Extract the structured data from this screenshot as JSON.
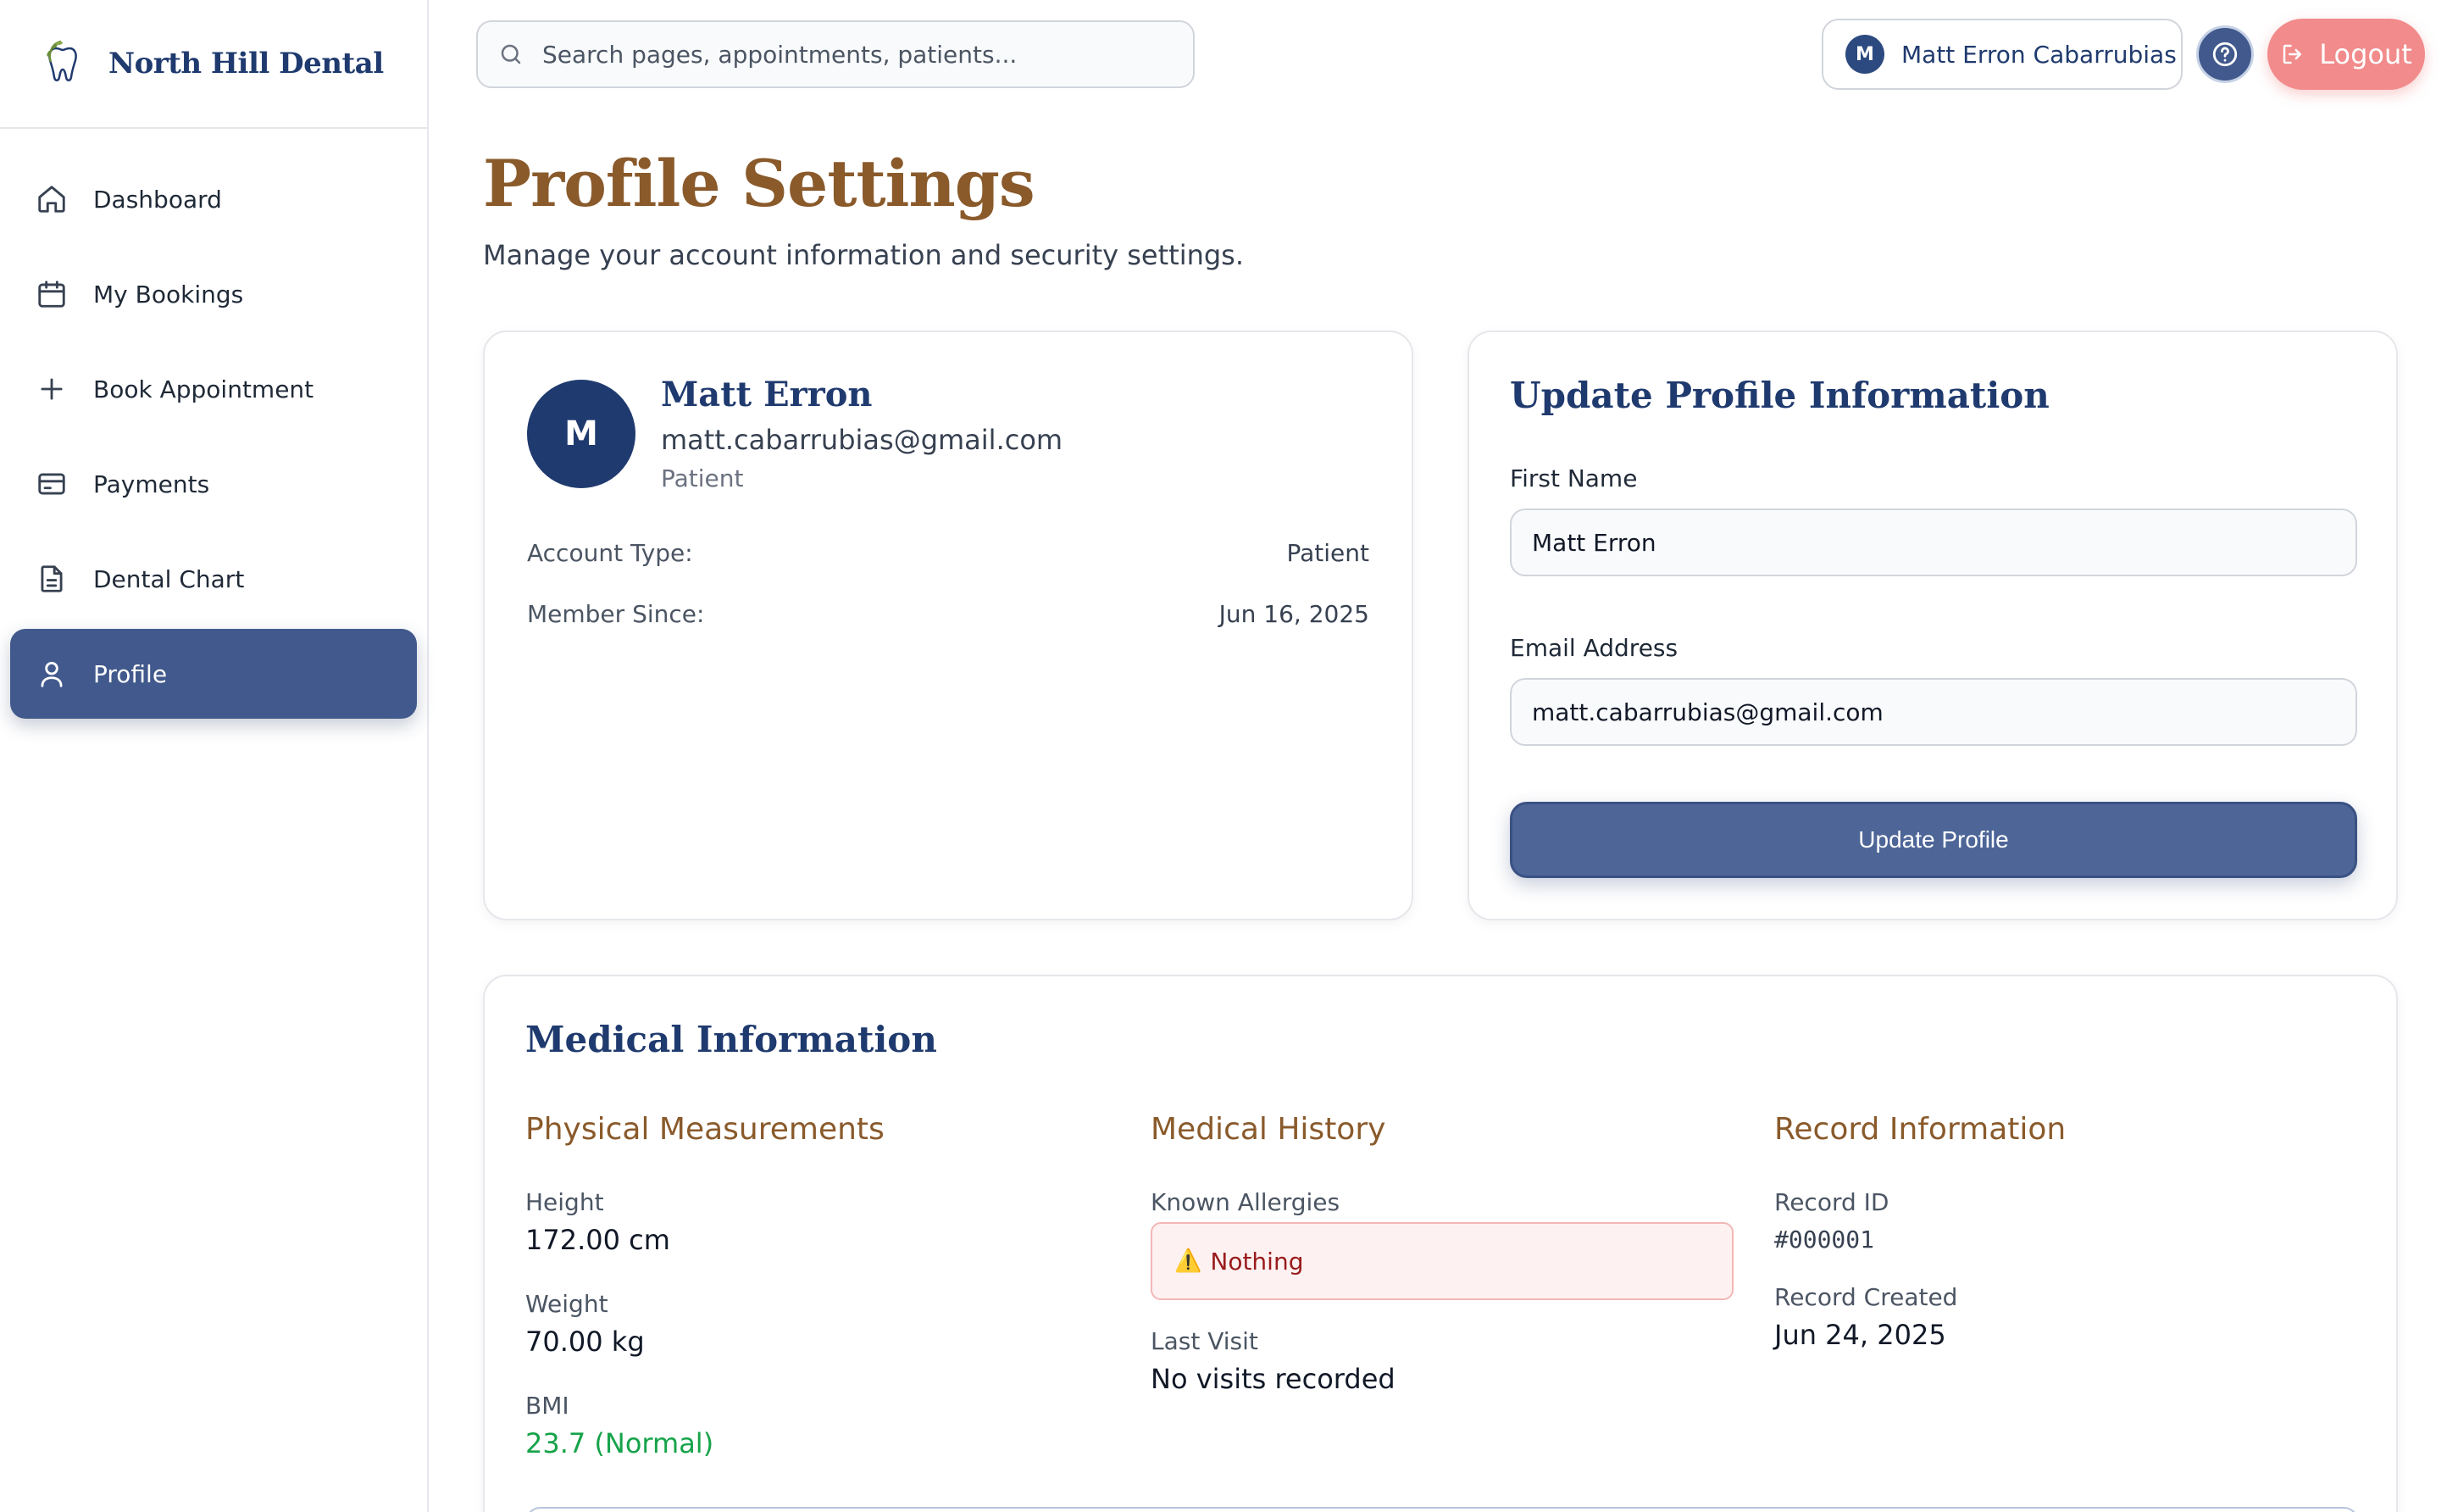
{
  "brand": {
    "name": "North Hill Dental"
  },
  "sidebar": {
    "items": [
      {
        "label": "Dashboard",
        "icon": "home-icon"
      },
      {
        "label": "My Bookings",
        "icon": "calendar-icon"
      },
      {
        "label": "Book Appointment",
        "icon": "plus-icon"
      },
      {
        "label": "Payments",
        "icon": "credit-card-icon"
      },
      {
        "label": "Dental Chart",
        "icon": "document-icon"
      },
      {
        "label": "Profile",
        "icon": "user-icon",
        "active": true
      }
    ]
  },
  "topbar": {
    "search_placeholder": "Search pages, appointments, patients...",
    "user_initial": "M",
    "user_name": "Matt Erron Cabarrubias",
    "logout_label": "Logout"
  },
  "header": {
    "title": "Profile Settings",
    "subtitle": "Manage your account information and security settings."
  },
  "profile_card": {
    "initial": "M",
    "name": "Matt Erron",
    "email": "matt.cabarrubias@gmail.com",
    "role": "Patient",
    "account_type_label": "Account Type:",
    "account_type_value": "Patient",
    "member_since_label": "Member Since:",
    "member_since_value": "Jun 16, 2025"
  },
  "update_card": {
    "title": "Update Profile Information",
    "first_name_label": "First Name",
    "first_name_value": "Matt Erron",
    "email_label": "Email Address",
    "email_value": "matt.cabarrubias@gmail.com",
    "button_label": "Update Profile"
  },
  "medical": {
    "title": "Medical Information",
    "physical": {
      "heading": "Physical Measurements",
      "height_label": "Height",
      "height_value": "172.00 cm",
      "weight_label": "Weight",
      "weight_value": "70.00 kg",
      "bmi_label": "BMI",
      "bmi_value": "23.7 (Normal)"
    },
    "history": {
      "heading": "Medical History",
      "allergies_label": "Known Allergies",
      "allergies_value": "Nothing",
      "last_visit_label": "Last Visit",
      "last_visit_value": "No visits recorded"
    },
    "record": {
      "heading": "Record Information",
      "id_label": "Record ID",
      "id_value": "#000001",
      "created_label": "Record Created",
      "created_value": "Jun 24, 2025"
    }
  },
  "colors": {
    "brand_navy": "#1f3a6e",
    "accent_brown": "#8a5a2b",
    "active_nav": "#41598c",
    "logout": "#f28b8b",
    "bmi_normal": "#16a34a"
  }
}
